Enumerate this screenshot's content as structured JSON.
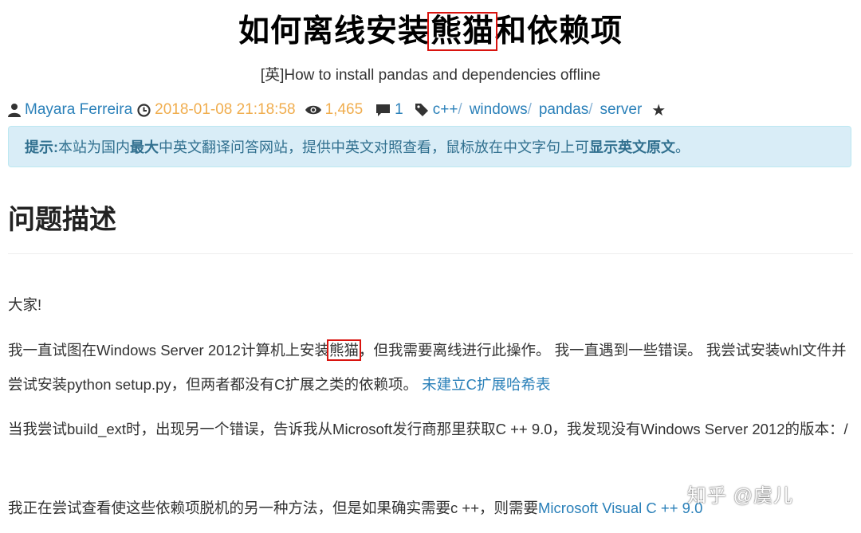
{
  "article": {
    "title_pre": "如何离线安装",
    "title_highlight": "熊猫",
    "title_post": "和依赖项",
    "subtitle": "[英]How to install pandas and dependencies offline",
    "meta": {
      "author": "Mayara Ferreira",
      "datetime": "2018-01-08 21:18:58",
      "views": "1,465",
      "comments": "1",
      "tags": [
        "c++",
        "windows",
        "pandas",
        "server"
      ],
      "tag_sep": "/"
    },
    "notice": {
      "label": "提示:",
      "text1": "本站为国内",
      "bold1": "最大",
      "text2": "中英文翻译问答网站，提供中英文对照查看，鼠标放在中文字句上可",
      "bold2": "显示英文原文",
      "text3": "。"
    },
    "section_heading": "问题描述",
    "paragraphs": {
      "p1": "大家!",
      "p2_pre": "我一直试图在Windows Server 2012计算机上安装",
      "p2_highlight": "熊猫",
      "p2_post": "，但我需要离线进行此操作。 我一直遇到一些错误。 我尝试安装whl文件并尝试安装python setup.py，但两者都没有C扩展之类的依赖项。 ",
      "p2_link": "未建立C扩展哈希表",
      "p3": "当我尝试build_ext时，出现另一个错误，告诉我从Microsoft发行商那里获取C ++ 9.0，我发现没有Windows Server 2012的版本：/",
      "p4_pre": "我正在尝试查看使这些依赖项脱机的另一种方法，但是如果确实需要c ++，则需要",
      "p4_link": "Microsoft Visual C ++ 9.0"
    }
  },
  "watermark": "知乎 @虞儿",
  "icons": {
    "author": "user-icon",
    "date": "clock-icon",
    "views": "eye-icon",
    "comments": "comment-icon",
    "tags": "tag-icon",
    "favorite": "star-icon"
  },
  "colors": {
    "link": "#2a80b9",
    "date_views": "#f0ad4e",
    "notice_bg": "#d9edf7",
    "notice_text": "#31708f",
    "highlight_box": "#d9140f"
  }
}
